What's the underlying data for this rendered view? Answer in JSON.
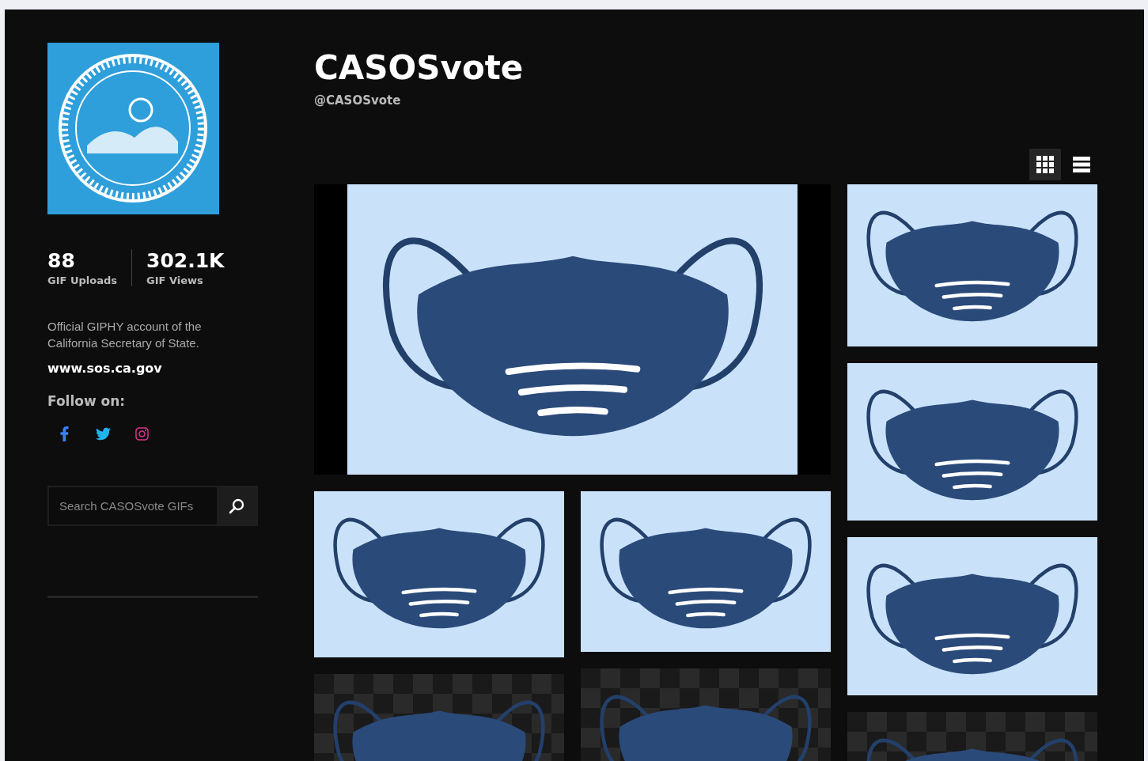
{
  "profile": {
    "display_name": "CASOSvote",
    "username": "@CASOSvote"
  },
  "stats": [
    {
      "value": "88",
      "label": "GIF Uploads"
    },
    {
      "value": "302.1K",
      "label": "GIF Views"
    }
  ],
  "bio": "Official GIPHY account of the California Secretary of State.",
  "website": "www.sos.ca.gov",
  "follow_label": "Follow on:",
  "socials": [
    {
      "kind": "facebook"
    },
    {
      "kind": "twitter"
    },
    {
      "kind": "instagram"
    }
  ],
  "search": {
    "placeholder": "Search CASOSvote GIFs"
  },
  "view_toggle": [
    {
      "kind": "grid",
      "selected": true
    },
    {
      "kind": "list",
      "selected": false
    }
  ],
  "gifs": {
    "featured": {
      "kind": "light"
    },
    "column_1": [
      {
        "kind": "light"
      },
      {
        "kind": "checkered"
      }
    ],
    "column_2": [
      {
        "kind": "light"
      },
      {
        "kind": "checkered"
      }
    ],
    "column_3": [
      {
        "kind": "light"
      },
      {
        "kind": "light"
      },
      {
        "kind": "light"
      },
      {
        "kind": "checkered"
      }
    ]
  }
}
